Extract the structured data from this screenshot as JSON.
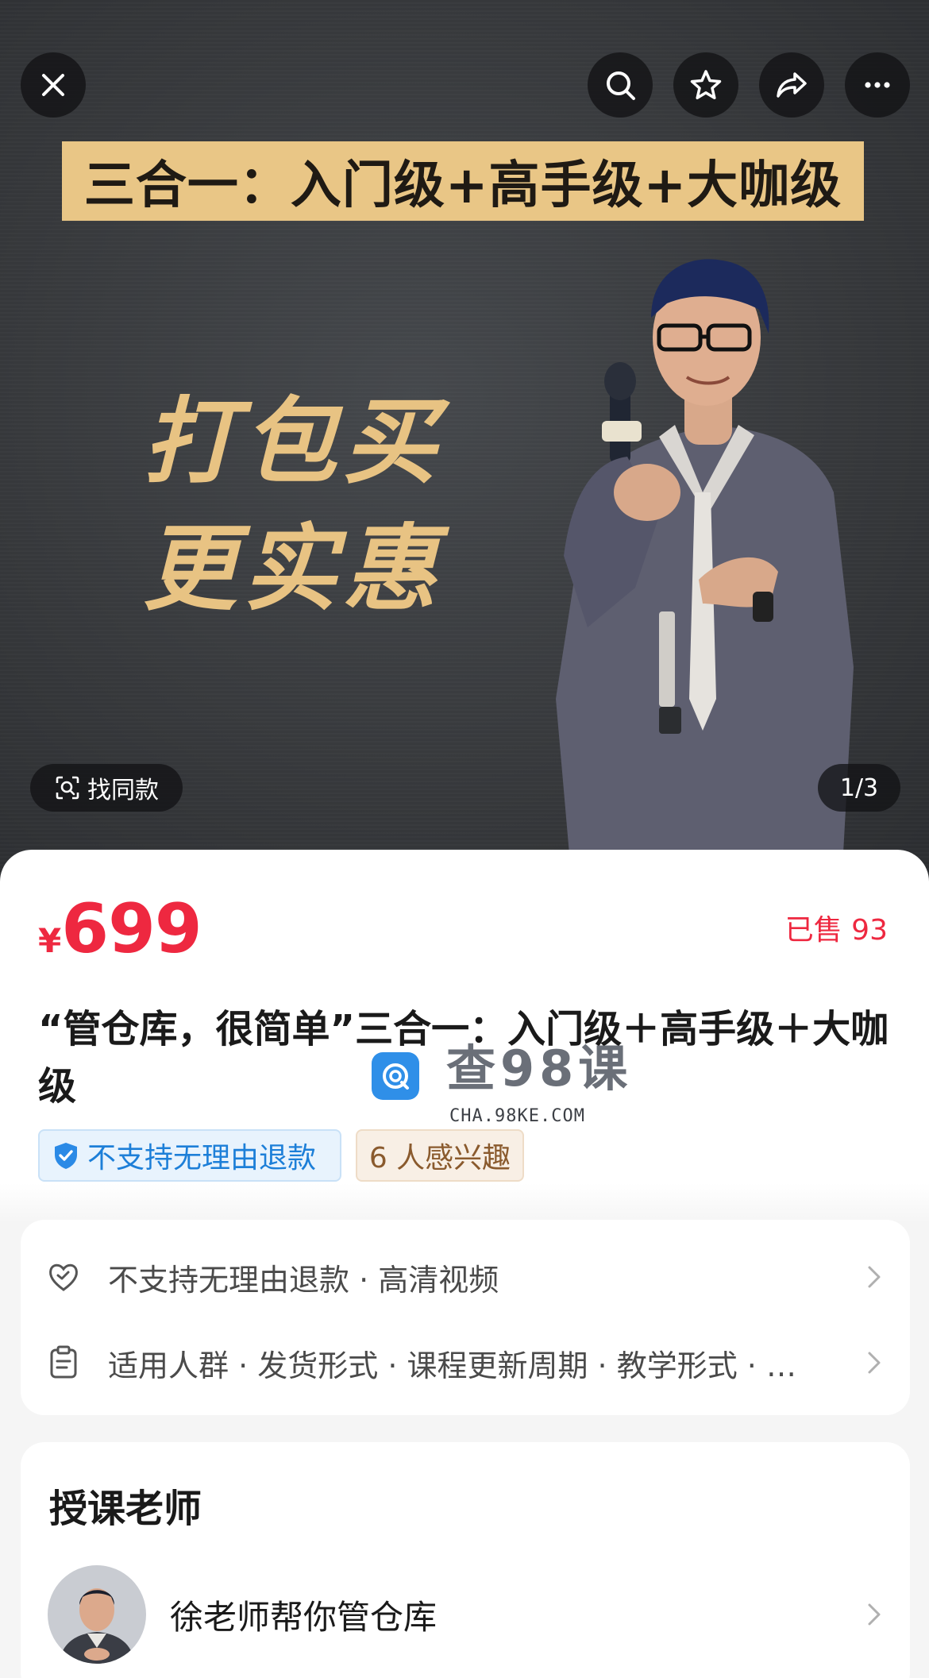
{
  "hero": {
    "banner_text": "三合一：入门级+高手级+大咖级",
    "slogan_line1": "打包买",
    "slogan_line2": "更实惠",
    "find_similar_label": "找同款",
    "page_counter": "1/3"
  },
  "top_bar": {
    "icons": [
      "close-icon",
      "search-icon",
      "star-icon",
      "share-icon",
      "more-icon"
    ]
  },
  "product": {
    "currency": "¥",
    "price": "699",
    "sold": "已售 93",
    "title": "“管仓库，很简单”三合一：入门级＋高手级＋大咖级",
    "tags": {
      "refund": "不支持无理由退款",
      "interest": "6 人感兴趣"
    }
  },
  "watermark": {
    "text": "查98课",
    "url": "CHA.98KE.COM"
  },
  "info": {
    "row1": "不支持无理由退款 · 高清视频",
    "row2": "适用人群 · 发货形式 · 课程更新周期 · 教学形式 · …"
  },
  "teacher": {
    "heading": "授课老师",
    "name": "徐老师帮你管仓库"
  },
  "colors": {
    "accent": "#ee2840",
    "banner": "#e9c686",
    "slogan": "#e8c383",
    "refund_blue": "#1d7fd8"
  }
}
